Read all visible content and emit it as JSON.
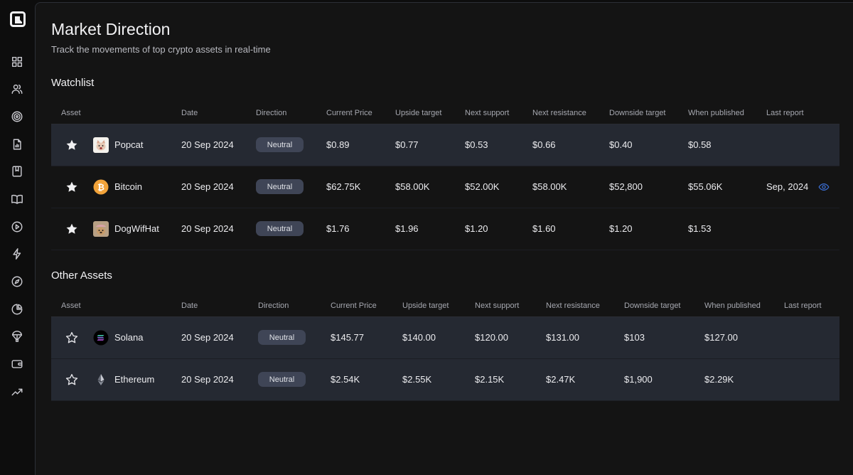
{
  "page": {
    "title": "Market Direction",
    "subtitle": "Track the movements of top crypto assets in real-time"
  },
  "sidebar": {
    "logo_icon": "brand-logo-icon",
    "items": [
      {
        "name": "dashboard",
        "icon": "grid-icon"
      },
      {
        "name": "community",
        "icon": "users-icon"
      },
      {
        "name": "targets",
        "icon": "target-icon"
      },
      {
        "name": "reports",
        "icon": "report-icon"
      },
      {
        "name": "journal",
        "icon": "bookmark-book-icon"
      },
      {
        "name": "learn",
        "icon": "open-book-icon"
      },
      {
        "name": "videos",
        "icon": "play-circle-icon"
      },
      {
        "name": "signals",
        "icon": "lightning-icon"
      },
      {
        "name": "explore",
        "icon": "compass-icon"
      },
      {
        "name": "portfolio",
        "icon": "pie-chart-icon"
      },
      {
        "name": "airdrops",
        "icon": "parachute-icon"
      },
      {
        "name": "wallet",
        "icon": "wallet-icon"
      },
      {
        "name": "trends",
        "icon": "trending-up-icon"
      }
    ]
  },
  "colors": {
    "accent_eye": "#3b6fd4",
    "row_shade": "#252932",
    "badge_bg": "#3f4556"
  },
  "watchlist": {
    "title": "Watchlist",
    "headers": [
      "Asset",
      "Date",
      "Direction",
      "Current Price",
      "Upside target",
      "Next support",
      "Next resistance",
      "Downside target",
      "When published",
      "Last report"
    ],
    "rows": [
      {
        "favorite": true,
        "asset": "Popcat",
        "date": "20 Sep 2024",
        "direction": "Neutral",
        "current_price": "$0.89",
        "upside_target": "$0.77",
        "next_support": "$0.53",
        "next_resistance": "$0.66",
        "downside_target": "$0.40",
        "when_published": "$0.58",
        "last_report": ""
      },
      {
        "favorite": true,
        "asset": "Bitcoin",
        "date": "20 Sep 2024",
        "direction": "Neutral",
        "current_price": "$62.75K",
        "upside_target": "$58.00K",
        "next_support": "$52.00K",
        "next_resistance": "$58.00K",
        "downside_target": "$52,800",
        "when_published": "$55.06K",
        "last_report": "Sep, 2024"
      },
      {
        "favorite": true,
        "asset": "DogWifHat",
        "date": "20 Sep 2024",
        "direction": "Neutral",
        "current_price": "$1.76",
        "upside_target": "$1.96",
        "next_support": "$1.20",
        "next_resistance": "$1.60",
        "downside_target": "$1.20",
        "when_published": "$1.53",
        "last_report": ""
      }
    ]
  },
  "other_assets": {
    "title": "Other Assets",
    "headers": [
      "Asset",
      "Date",
      "Direction",
      "Current Price",
      "Upside target",
      "Next support",
      "Next resistance",
      "Downside target",
      "When published",
      "Last report"
    ],
    "rows": [
      {
        "favorite": false,
        "asset": "Solana",
        "date": "20 Sep 2024",
        "direction": "Neutral",
        "current_price": "$145.77",
        "upside_target": "$140.00",
        "next_support": "$120.00",
        "next_resistance": "$131.00",
        "downside_target": "$103",
        "when_published": "$127.00",
        "last_report": ""
      },
      {
        "favorite": false,
        "asset": "Ethereum",
        "date": "20 Sep 2024",
        "direction": "Neutral",
        "current_price": "$2.54K",
        "upside_target": "$2.55K",
        "next_support": "$2.15K",
        "next_resistance": "$2.47K",
        "downside_target": "$1,900",
        "when_published": "$2.29K",
        "last_report": ""
      }
    ]
  }
}
